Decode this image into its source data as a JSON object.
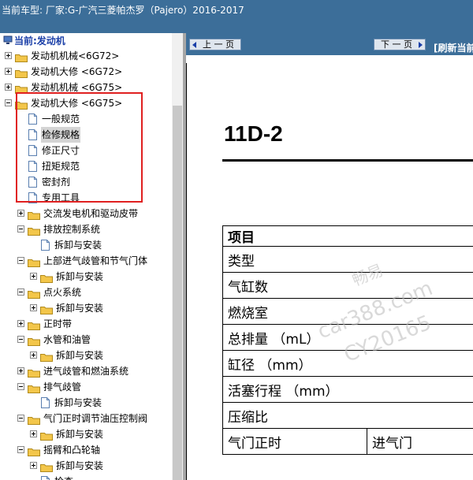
{
  "header": {
    "title": "当前车型:   厂家:G-广汽三菱帕杰罗（Pajero）2016-2017"
  },
  "tree": {
    "root_label": "当前:发动机",
    "nodes": [
      {
        "label": "发动机机械<6G72>",
        "type": "folder",
        "level": 0,
        "expander": "plus"
      },
      {
        "label": "发动机大修 <6G72>",
        "type": "folder",
        "level": 0,
        "expander": "plus"
      },
      {
        "label": "发动机机械 <6G75>",
        "type": "folder",
        "level": 0,
        "expander": "plus"
      },
      {
        "label": "发动机大修 <6G75>",
        "type": "folder",
        "level": 0,
        "expander": "minus"
      },
      {
        "label": "一般规范",
        "type": "doc",
        "level": 1
      },
      {
        "label": "检修规格",
        "type": "doc",
        "level": 1,
        "selected": true
      },
      {
        "label": "修正尺寸",
        "type": "doc",
        "level": 1
      },
      {
        "label": "扭矩规范",
        "type": "doc",
        "level": 1
      },
      {
        "label": "密封剂",
        "type": "doc",
        "level": 1
      },
      {
        "label": "专用工具",
        "type": "doc",
        "level": 1
      },
      {
        "label": "交流发电机和驱动皮带",
        "type": "folder",
        "level": 1,
        "expander": "plus"
      },
      {
        "label": "排放控制系统",
        "type": "folder",
        "level": 1,
        "expander": "minus"
      },
      {
        "label": "拆卸与安装",
        "type": "doc",
        "level": 2
      },
      {
        "label": "上部进气歧管和节气门体",
        "type": "folder",
        "level": 1,
        "expander": "minus"
      },
      {
        "label": "拆卸与安装",
        "type": "folder",
        "level": 2,
        "expander": "plus"
      },
      {
        "label": "点火系统",
        "type": "folder",
        "level": 1,
        "expander": "minus"
      },
      {
        "label": "拆卸与安装",
        "type": "folder",
        "level": 2,
        "expander": "plus"
      },
      {
        "label": "正时带",
        "type": "folder",
        "level": 1,
        "expander": "plus"
      },
      {
        "label": "水管和油管",
        "type": "folder",
        "level": 1,
        "expander": "minus"
      },
      {
        "label": "拆卸与安装",
        "type": "folder",
        "level": 2,
        "expander": "plus"
      },
      {
        "label": "进气歧管和燃油系统",
        "type": "folder",
        "level": 1,
        "expander": "plus"
      },
      {
        "label": "排气歧管",
        "type": "folder",
        "level": 1,
        "expander": "minus"
      },
      {
        "label": "拆卸与安装",
        "type": "doc",
        "level": 2
      },
      {
        "label": "气门正时调节油压控制阀",
        "type": "folder",
        "level": 1,
        "expander": "minus"
      },
      {
        "label": "拆卸与安装",
        "type": "folder",
        "level": 2,
        "expander": "plus"
      },
      {
        "label": "摇臂和凸轮轴",
        "type": "folder",
        "level": 1,
        "expander": "minus"
      },
      {
        "label": "拆卸与安装",
        "type": "folder",
        "level": 2,
        "expander": "plus"
      },
      {
        "label": "检查",
        "type": "doc",
        "level": 2
      }
    ]
  },
  "nav": {
    "prev": "上 一 页",
    "next": "下 一 页",
    "refresh": "[刷新当前"
  },
  "document": {
    "page_code": "11D-2",
    "table_header": "项目",
    "rows": [
      "类型",
      "气缸数",
      "燃烧室",
      "总排量 （mL）",
      "缸径 （mm）",
      "活塞行程 （mm）",
      "压缩比"
    ],
    "last_row": {
      "col1": "气门正时",
      "col2": "进气门"
    }
  },
  "watermark": {
    "line1": "畅易",
    "line2": "car388.com",
    "line3": "CY20165"
  },
  "colors": {
    "header_bg": "#3c6e99",
    "selection_bg": "#d4d4d4",
    "highlight_border": "#e02020",
    "folder": "#f3c64a",
    "link_blue": "#1a3fa8"
  }
}
